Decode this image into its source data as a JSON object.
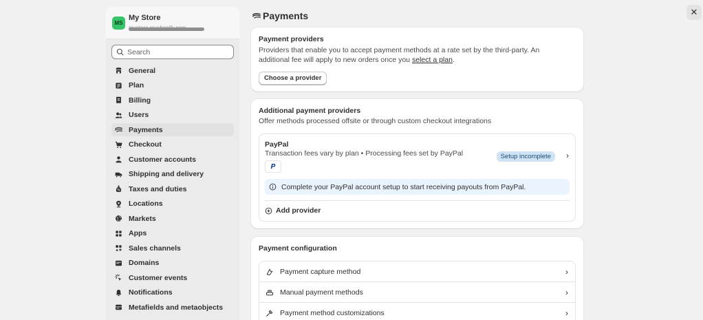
{
  "window": {
    "close_label": "✕"
  },
  "store": {
    "initials": "MS",
    "name": "My Store",
    "url": "mystore.myshopify.com"
  },
  "search": {
    "placeholder": "Search"
  },
  "sidebar": {
    "items": [
      {
        "label": "General",
        "icon": "store-icon"
      },
      {
        "label": "Plan",
        "icon": "plan-icon"
      },
      {
        "label": "Billing",
        "icon": "billing-icon"
      },
      {
        "label": "Users",
        "icon": "users-icon"
      },
      {
        "label": "Payments",
        "icon": "payments-icon",
        "active": true
      },
      {
        "label": "Checkout",
        "icon": "cart-icon"
      },
      {
        "label": "Customer accounts",
        "icon": "person-icon"
      },
      {
        "label": "Shipping and delivery",
        "icon": "truck-icon"
      },
      {
        "label": "Taxes and duties",
        "icon": "tax-icon"
      },
      {
        "label": "Locations",
        "icon": "location-icon"
      },
      {
        "label": "Markets",
        "icon": "globe-icon"
      },
      {
        "label": "Apps",
        "icon": "apps-icon"
      },
      {
        "label": "Sales channels",
        "icon": "channels-icon"
      },
      {
        "label": "Domains",
        "icon": "domain-icon"
      },
      {
        "label": "Customer events",
        "icon": "events-icon"
      },
      {
        "label": "Notifications",
        "icon": "bell-icon"
      },
      {
        "label": "Metafields and metaobjects",
        "icon": "metafields-icon"
      }
    ]
  },
  "page": {
    "title": "Payments"
  },
  "providers": {
    "title": "Payment providers",
    "text_before": "Providers that enable you to accept payment methods at a rate set by the third-party. An additional fee will apply to new orders once you ",
    "link": "select a plan",
    "text_after": ".",
    "button": "Choose a provider"
  },
  "additional": {
    "title": "Additional payment providers",
    "subtitle": "Offer methods processed offsite or through custom checkout integrations",
    "paypal": {
      "name": "PayPal",
      "fees": "Transaction fees vary by plan • Processing fees set by PayPal",
      "logo": "P",
      "badge": "Setup incomplete",
      "banner": "Complete your PayPal account setup to start receiving payouts from PayPal."
    },
    "add_provider": "Add provider"
  },
  "config": {
    "title": "Payment configuration",
    "rows": [
      {
        "label": "Payment capture method"
      },
      {
        "label": "Manual payment methods"
      },
      {
        "label": "Payment method customizations"
      }
    ]
  },
  "colors": {
    "background": "#f1f1f1",
    "card": "#ffffff",
    "avatar": "#36c36a",
    "badge": "#cfe3f5",
    "banner": "#eaf4ff"
  }
}
